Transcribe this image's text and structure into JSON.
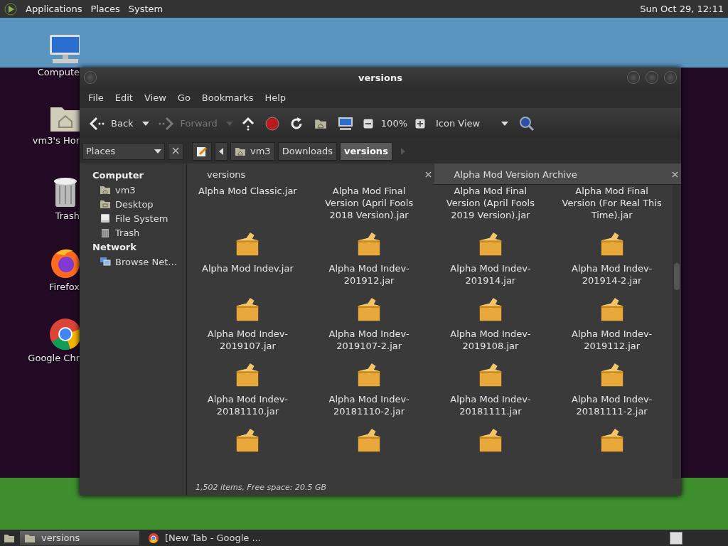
{
  "top_panel": {
    "menus": [
      "Applications",
      "Places",
      "System"
    ],
    "clock": "Sun Oct 29, 12:11"
  },
  "desktop_icons": [
    {
      "kind": "computer",
      "label": "Compute"
    },
    {
      "kind": "home",
      "label": "vm3's Hor"
    },
    {
      "kind": "trash",
      "label": "Trash"
    },
    {
      "kind": "firefox",
      "label": "Firefox"
    },
    {
      "kind": "chrome",
      "label": "Google Chr"
    }
  ],
  "window": {
    "title": "versions",
    "menu": [
      "File",
      "Edit",
      "View",
      "Go",
      "Bookmarks",
      "Help"
    ],
    "toolbar": {
      "back": "Back",
      "forward": {
        "label": "Forward",
        "disabled": true
      },
      "zoom": "100%",
      "view": "Icon View"
    },
    "sidebar": {
      "selector": "Places",
      "sections": [
        {
          "label": "Computer",
          "children": [
            {
              "kind": "home",
              "label": "vm3"
            },
            {
              "kind": "desktop",
              "label": "Desktop"
            },
            {
              "kind": "drive",
              "label": "File System"
            },
            {
              "kind": "trash",
              "label": "Trash"
            }
          ]
        },
        {
          "label": "Network",
          "children": [
            {
              "kind": "network",
              "label": "Browse Net…"
            }
          ]
        }
      ]
    },
    "path": [
      {
        "label": "vm3",
        "kind": "home",
        "selected": false
      },
      {
        "label": "Downloads",
        "kind": "folder",
        "selected": false
      },
      {
        "label": "versions",
        "kind": "folder",
        "selected": true
      }
    ],
    "tabs": [
      {
        "label": "versions",
        "selected": true
      },
      {
        "label": "Alpha Mod Version Archive",
        "selected": false
      }
    ],
    "files": [
      {
        "kind": "label_only",
        "label": "Alpha Mod Classic.jar"
      },
      {
        "kind": "label_only",
        "label": "Alpha Mod Final Version (April Fools 2018 Version).jar"
      },
      {
        "kind": "label_only",
        "label": "Alpha Mod Final Version (April Fools 2019 Version).jar"
      },
      {
        "kind": "label_only",
        "label": "Alpha Mod Final Version (For Real This Time).jar"
      },
      {
        "kind": "icon_label",
        "label": "Alpha Mod Indev.jar"
      },
      {
        "kind": "icon_label",
        "label": "Alpha Mod Indev-201912.jar"
      },
      {
        "kind": "icon_label",
        "label": "Alpha Mod Indev-201914.jar"
      },
      {
        "kind": "icon_label",
        "label": "Alpha Mod Indev-201914-2.jar"
      },
      {
        "kind": "icon_label",
        "label": "Alpha Mod Indev-2019107.jar"
      },
      {
        "kind": "icon_label",
        "label": "Alpha Mod Indev-2019107-2.jar"
      },
      {
        "kind": "icon_label",
        "label": "Alpha Mod Indev-2019108.jar"
      },
      {
        "kind": "icon_label",
        "label": "Alpha Mod Indev-2019112.jar"
      },
      {
        "kind": "icon_label",
        "label": "Alpha Mod Indev-20181110.jar"
      },
      {
        "kind": "icon_label",
        "label": "Alpha Mod Indev-20181110-2.jar"
      },
      {
        "kind": "icon_label",
        "label": "Alpha Mod Indev-20181111.jar"
      },
      {
        "kind": "icon_label",
        "label": "Alpha Mod Indev-20181111-2.jar"
      },
      {
        "kind": "icon_only"
      },
      {
        "kind": "icon_only"
      },
      {
        "kind": "icon_only"
      },
      {
        "kind": "icon_only"
      }
    ],
    "status": "1,502 items, Free space: 20.5 GB"
  },
  "taskbar": [
    {
      "kind": "folder",
      "label": "versions",
      "selected": true
    },
    {
      "kind": "chrome",
      "label": "[New Tab - Google ...",
      "selected": false
    }
  ]
}
